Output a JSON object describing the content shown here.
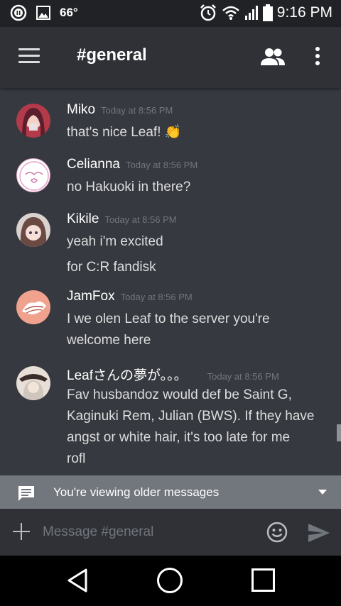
{
  "status_bar": {
    "temperature": "66°",
    "time": "9:16 PM",
    "icons": [
      "notification-pause-icon",
      "image-icon",
      "alarm-icon",
      "wifi-icon",
      "signal-icon",
      "battery-icon"
    ]
  },
  "toolbar": {
    "channel": "#general",
    "icons": [
      "hamburger-menu-icon",
      "members-icon",
      "overflow-menu-icon"
    ]
  },
  "messages": [
    {
      "author": "Miko",
      "timestamp": "Today at 8:56 PM",
      "lines": [
        "that's nice Leaf! 👏"
      ]
    },
    {
      "author": "Celianna",
      "timestamp": "Today at 8:56 PM",
      "lines": [
        "no Hakuoki in there?"
      ]
    },
    {
      "author": "Kikile",
      "timestamp": "Today at 8:56 PM",
      "lines": [
        "yeah i'm excited",
        "for C:R fandisk"
      ]
    },
    {
      "author": "JamFox",
      "timestamp": "Today at 8:56 PM",
      "lines": [
        "I we olen Leaf to the server you're",
        "welcome here"
      ]
    },
    {
      "author": "Leafさんの夢が。。。",
      "timestamp": "Today at 8:56 PM",
      "lines": [
        "Fav husbandoz would def be Saint G,",
        "Kaginuki Rem, Julian (BWS). If they have",
        "angst or white hair, it's too late for me",
        "rofl"
      ]
    }
  ],
  "older_messages_bar": {
    "label": "You're viewing older messages"
  },
  "composer": {
    "placeholder": "Message #general"
  },
  "colors": {
    "background": "#36393f",
    "toolbar": "#2f3136",
    "status_bar": "#202225",
    "older_bar": "#72767d",
    "timestamp": "#72767d"
  }
}
